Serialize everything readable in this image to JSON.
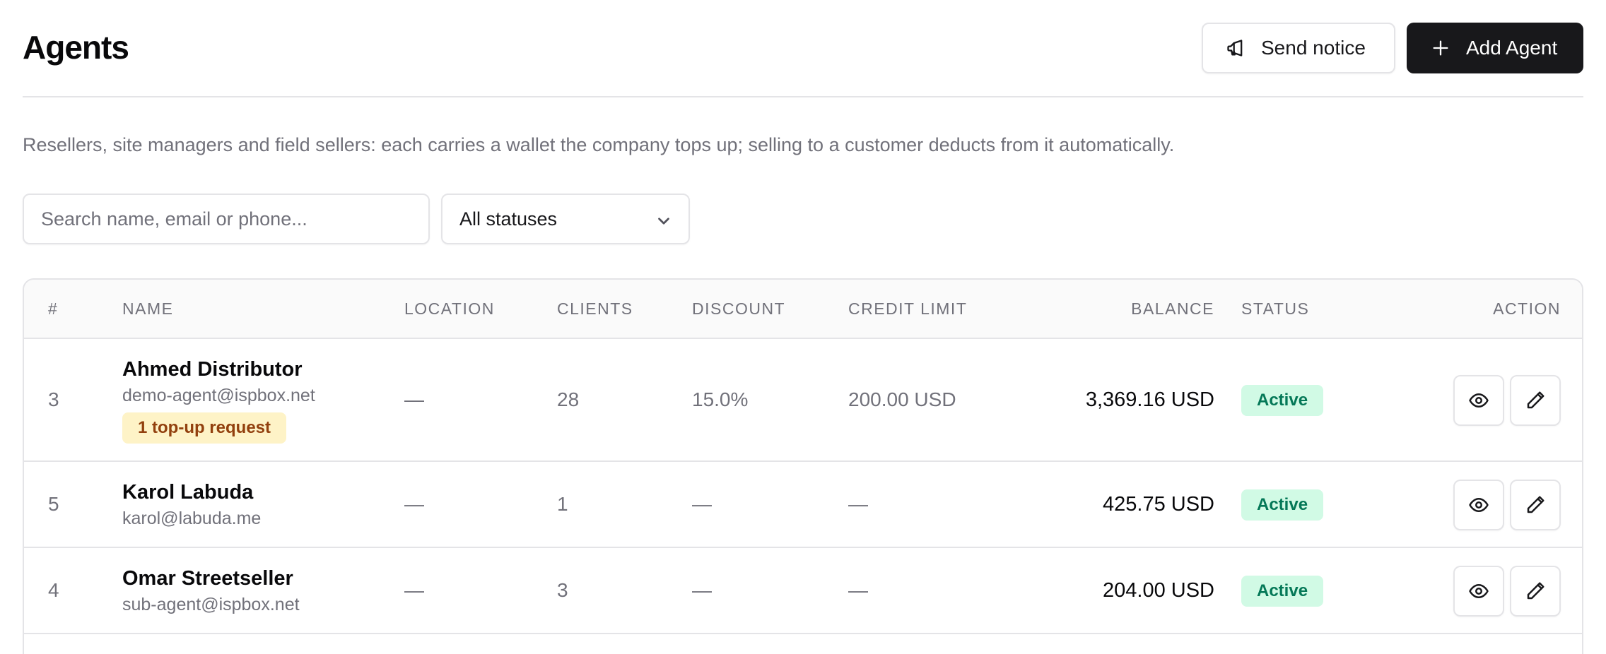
{
  "header": {
    "title": "Agents",
    "send_notice_label": "Send notice",
    "add_agent_label": "Add Agent"
  },
  "subtitle": "Resellers, site managers and field sellers: each carries a wallet the company tops up; selling to a customer deducts from it automatically.",
  "filters": {
    "search_placeholder": "Search name, email or phone...",
    "status_selected": "All statuses"
  },
  "table": {
    "columns": {
      "num": "#",
      "name": "NAME",
      "location": "LOCATION",
      "clients": "CLIENTS",
      "discount": "DISCOUNT",
      "credit_limit": "CREDIT LIMIT",
      "balance": "BALANCE",
      "status": "STATUS",
      "action": "ACTION"
    },
    "rows": [
      {
        "id": "3",
        "name": "Ahmed Distributor",
        "email": "demo-agent@ispbox.net",
        "tag": "1 top-up request",
        "location": "—",
        "clients": "28",
        "discount": "15.0%",
        "credit_limit": "200.00 USD",
        "balance": "3,369.16 USD",
        "status": "Active"
      },
      {
        "id": "5",
        "name": "Karol Labuda",
        "email": "karol@labuda.me",
        "location": "—",
        "clients": "1",
        "discount": "—",
        "credit_limit": "—",
        "balance": "425.75 USD",
        "status": "Active"
      },
      {
        "id": "4",
        "name": "Omar Streetseller",
        "email": "sub-agent@ispbox.net",
        "location": "—",
        "clients": "3",
        "discount": "—",
        "credit_limit": "—",
        "balance": "204.00 USD",
        "status": "Active"
      }
    ]
  },
  "icons": {
    "send_notice": "megaphone-icon",
    "add_agent": "plus-icon",
    "status_select": "chevron-down-icon",
    "view": "eye-icon",
    "edit": "pencil-icon"
  },
  "colors": {
    "primary": "#18181b",
    "active_badge_bg": "#d1fae5",
    "active_badge_text": "#047857",
    "request_tag_bg": "#fef3c7",
    "request_tag_text": "#92400e"
  }
}
